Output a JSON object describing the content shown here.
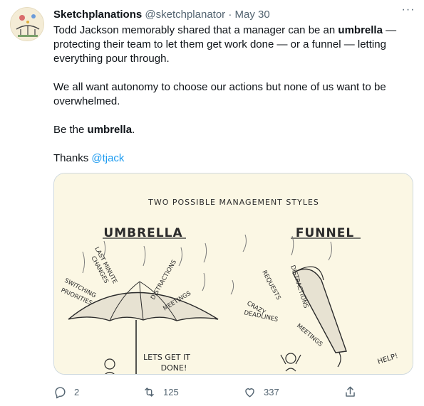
{
  "author": {
    "name": "Sketchplanations",
    "handle": "@sketchplanator",
    "separator": "·",
    "date": "May 30"
  },
  "more_label": "···",
  "tweet": {
    "p1_a": "Todd Jackson memorably shared that a manager can be an ",
    "p1_bold": "umbrella",
    "p1_b": " — protecting their team to let them get work done — or a funnel — letting everything pour through.",
    "p2": "We all want autonomy to choose our actions but none of us want to be overwhelmed.",
    "p3_a": "Be the ",
    "p3_bold": "umbrella",
    "p3_b": ".",
    "p4_a": "Thanks ",
    "p4_mention": "@tjack"
  },
  "image": {
    "title": "TWO POSSIBLE MANAGEMENT STYLES",
    "umbrella_title": "UMBRELLA",
    "funnel_title": "FUNNEL",
    "umbrella_words": {
      "last_minute": "LAST MINUTE",
      "changes": "CHANGES",
      "switching": "SWITCHING",
      "priorities": "PRIORITIES",
      "distractions": "DISTRACTIONS",
      "meetings": "MEETINGS"
    },
    "funnel_words": {
      "requests": "REQUESTS",
      "distractions": "DISTRACTIONS",
      "crazy": "CRAZY",
      "deadlines": "DEADLINES",
      "meetings": "MEETINGS"
    },
    "lets_get_it": "LETS GET IT",
    "done": "DONE!",
    "help": "HELP!"
  },
  "actions": {
    "replies": "2",
    "retweets": "125",
    "likes": "337"
  },
  "colors": {
    "link": "#1d9bf0",
    "text": "#0f1419",
    "secondary": "#536471",
    "image_bg": "#fbf7e4"
  }
}
